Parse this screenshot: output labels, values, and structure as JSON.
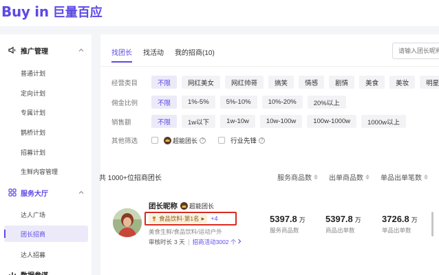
{
  "logo": {
    "en": "Buy in",
    "cn": "巨量百应"
  },
  "sidebar": {
    "group1": {
      "label": "推广管理"
    },
    "items1": [
      "普通计划",
      "定向计划",
      "专属计划",
      "鹊桥计划",
      "招募计划",
      "生鲜内容管理"
    ],
    "group2": {
      "label": "服务大厅"
    },
    "items2": [
      "达人广场",
      "团长招商",
      "达人招募"
    ],
    "group3": {
      "label": "数据参谋"
    }
  },
  "tabs": [
    "找团长",
    "找活动",
    "我的招商(10)"
  ],
  "search": {
    "placeholder": "请输入团长昵称"
  },
  "filters": {
    "category": {
      "label": "经营类目",
      "options": [
        "不限",
        "网红美女",
        "网红帅哥",
        "搞笑",
        "情感",
        "剧情",
        "美食",
        "美妆",
        "明星"
      ]
    },
    "commission": {
      "label": "佣金比例",
      "options": [
        "不限",
        "1%-5%",
        "5%-10%",
        "10%-20%",
        "20%以上"
      ]
    },
    "sales": {
      "label": "销售额",
      "options": [
        "不限",
        "1w以下",
        "1w-10w",
        "10w-100w",
        "100w-1000w",
        "1000w以上"
      ]
    },
    "other": {
      "label": "其他筛选",
      "check1": "超能团长",
      "check2": "行业先锋"
    }
  },
  "list": {
    "count": "共 1000+位招商团长",
    "columns": [
      "服务商品数",
      "出单商品数",
      "单品出单笔数"
    ]
  },
  "card": {
    "name": "团长昵称",
    "badge": "超能团长",
    "rank": "食品饮料·第1名",
    "rank_more": "+4",
    "categories": "美食生鲜/食品饮料/运动户外",
    "review_label": "审核时长",
    "review_value": "3 天",
    "activity": "招商活动3002 个",
    "stats": [
      {
        "num": "5397.8",
        "unit": "万",
        "label": "服务商品数"
      },
      {
        "num": "5397.8",
        "unit": "万",
        "label": "商品出单数"
      },
      {
        "num": "3726.8",
        "unit": "万",
        "label": "单品出单数"
      }
    ]
  },
  "colors": {
    "accent": "#5b49e6",
    "highlight_border": "#d8291f"
  }
}
